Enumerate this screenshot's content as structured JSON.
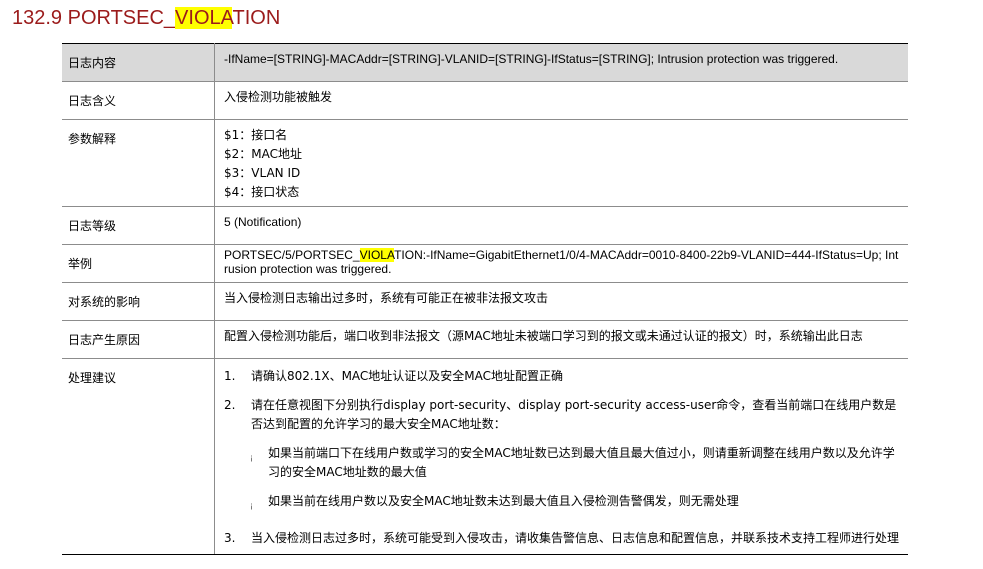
{
  "title": {
    "pre": "132.9  PORTSEC_",
    "hl": "VIOLA",
    "post": "TION"
  },
  "rows": [
    {
      "label": "日志内容",
      "text": "-IfName=[STRING]-MACAddr=[STRING]-VLANID=[STRING]-IfStatus=[STRING]; Intrusion protection was triggered."
    },
    {
      "label": "日志含义",
      "text": "入侵检测功能被触发"
    },
    {
      "label": "参数解释",
      "params": [
        "$1：接口名",
        "$2：MAC地址",
        "$3：VLAN ID",
        "$4：接口状态"
      ]
    },
    {
      "label": "日志等级",
      "text": "5 (Notification)"
    },
    {
      "label": "举例",
      "ex_pre": "PORTSEC/5/PORTSEC_",
      "ex_hl": "VIOLA",
      "ex_post": "TION:-IfName=GigabitEthernet1/0/4-MACAddr=0010-8400-22b9-VLANID=444-IfStatus=Up; Intrusion protection was triggered."
    },
    {
      "label": "对系统的影响",
      "text": "当入侵检测日志输出过多时，系统有可能正在被非法报文攻击"
    },
    {
      "label": "日志产生原因",
      "text": "配置入侵检测功能后，端口收到非法报文（源MAC地址未被端口学习到的报文或未通过认证的报文）时，系统输出此日志"
    },
    {
      "label": "处理建议",
      "steps": [
        {
          "num": "1.",
          "text": "请确认802.1X、MAC地址认证以及安全MAC地址配置正确"
        },
        {
          "num": "2.",
          "text": "请在任意视图下分别执行display port-security、display port-security access-user命令，查看当前端口在线用户数是否达到配置的允许学习的最大安全MAC地址数："
        },
        {
          "num": "3.",
          "text": "当入侵检测日志过多时，系统可能受到入侵攻击，请收集告警信息、日志信息和配置信息，并联系技术支持工程师进行处理"
        }
      ],
      "bullet_glyph": "¡",
      "bullets": [
        "如果当前端口下在线用户数或学习的安全MAC地址数已达到最大值且最大值过小，则请重新调整在线用户数以及允许学习的安全MAC地址数的最大值",
        "如果当前在线用户数以及安全MAC地址数未达到最大值且入侵检测告警偶发，则无需处理"
      ]
    }
  ]
}
